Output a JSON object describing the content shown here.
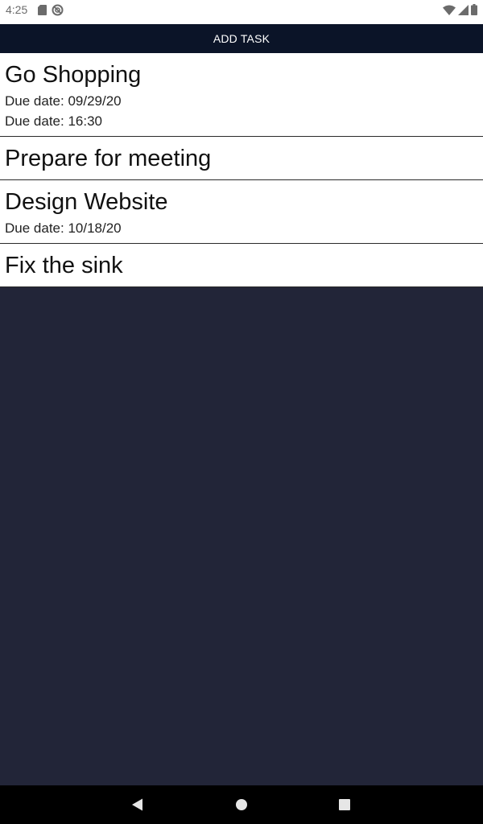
{
  "status_bar": {
    "time": "4:25",
    "left_icons": [
      "sd-card-icon",
      "do-not-disturb-icon"
    ],
    "right_icons": [
      "wifi-icon",
      "cell-signal-icon",
      "battery-icon"
    ]
  },
  "toolbar": {
    "add_task_label": "ADD TASK"
  },
  "tasks": [
    {
      "title": "Go Shopping",
      "due_date": "Due date: 09/29/20",
      "due_time": "Due date: 16:30"
    },
    {
      "title": "Prepare for meeting"
    },
    {
      "title": "Design Website",
      "due_date": "Due date: 10/18/20"
    },
    {
      "title": "Fix the sink"
    }
  ],
  "nav_bar": {
    "buttons": [
      "back-icon",
      "home-icon",
      "recents-icon"
    ]
  },
  "colors": {
    "toolbar_bg": "#0b1428",
    "background": "#222538",
    "list_bg": "#ffffff"
  }
}
